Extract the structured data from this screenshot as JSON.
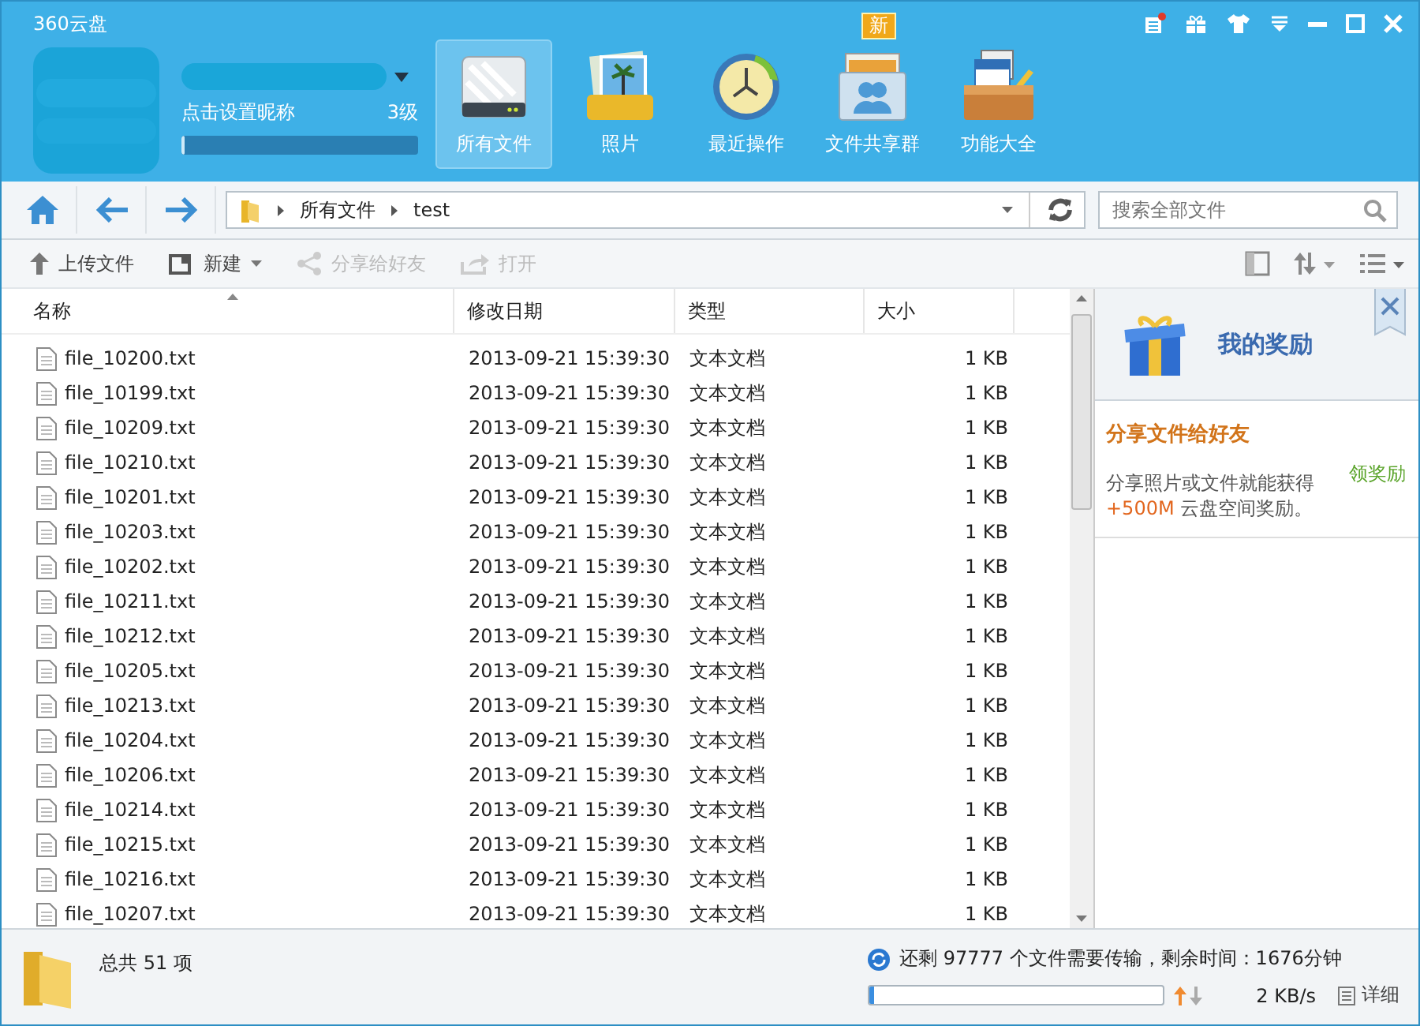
{
  "app_title": "360云盘",
  "user": {
    "setting_prompt": "点击设置昵称",
    "grade": "3级",
    "level": 0.01
  },
  "nav_tabs": [
    {
      "label": "所有文件",
      "kind": "drive",
      "selected": true
    },
    {
      "label": "照片",
      "kind": "photos",
      "selected": false
    },
    {
      "label": "最近操作",
      "kind": "clock",
      "selected": false
    },
    {
      "label": "文件共享群",
      "kind": "share",
      "selected": false,
      "badge": "新"
    },
    {
      "label": "功能大全",
      "kind": "toolbox",
      "selected": false
    }
  ],
  "breadcrumb": [
    "所有文件",
    "test"
  ],
  "search": {
    "placeholder": "搜索全部文件"
  },
  "toolbar": [
    {
      "label": "上传文件",
      "kind": "upload",
      "disabled": false,
      "dropdown": false
    },
    {
      "label": "新建",
      "kind": "new",
      "disabled": false,
      "dropdown": true
    },
    {
      "label": "分享给好友",
      "kind": "share",
      "disabled": true,
      "dropdown": false
    },
    {
      "label": "打开",
      "kind": "open",
      "disabled": true,
      "dropdown": false
    }
  ],
  "table": {
    "columns": [
      "名称",
      "修改日期",
      "类型",
      "大小"
    ],
    "rows": [
      {
        "name": "file_10200.txt",
        "modified": "2013-09-21 15:39:30",
        "type": "文本文档",
        "size": "1 KB"
      },
      {
        "name": "file_10199.txt",
        "modified": "2013-09-21 15:39:30",
        "type": "文本文档",
        "size": "1 KB"
      },
      {
        "name": "file_10209.txt",
        "modified": "2013-09-21 15:39:30",
        "type": "文本文档",
        "size": "1 KB"
      },
      {
        "name": "file_10210.txt",
        "modified": "2013-09-21 15:39:30",
        "type": "文本文档",
        "size": "1 KB"
      },
      {
        "name": "file_10201.txt",
        "modified": "2013-09-21 15:39:30",
        "type": "文本文档",
        "size": "1 KB"
      },
      {
        "name": "file_10203.txt",
        "modified": "2013-09-21 15:39:30",
        "type": "文本文档",
        "size": "1 KB"
      },
      {
        "name": "file_10202.txt",
        "modified": "2013-09-21 15:39:30",
        "type": "文本文档",
        "size": "1 KB"
      },
      {
        "name": "file_10211.txt",
        "modified": "2013-09-21 15:39:30",
        "type": "文本文档",
        "size": "1 KB"
      },
      {
        "name": "file_10212.txt",
        "modified": "2013-09-21 15:39:30",
        "type": "文本文档",
        "size": "1 KB"
      },
      {
        "name": "file_10205.txt",
        "modified": "2013-09-21 15:39:30",
        "type": "文本文档",
        "size": "1 KB"
      },
      {
        "name": "file_10213.txt",
        "modified": "2013-09-21 15:39:30",
        "type": "文本文档",
        "size": "1 KB"
      },
      {
        "name": "file_10204.txt",
        "modified": "2013-09-21 15:39:30",
        "type": "文本文档",
        "size": "1 KB"
      },
      {
        "name": "file_10206.txt",
        "modified": "2013-09-21 15:39:30",
        "type": "文本文档",
        "size": "1 KB"
      },
      {
        "name": "file_10214.txt",
        "modified": "2013-09-21 15:39:30",
        "type": "文本文档",
        "size": "1 KB"
      },
      {
        "name": "file_10215.txt",
        "modified": "2013-09-21 15:39:30",
        "type": "文本文档",
        "size": "1 KB"
      },
      {
        "name": "file_10216.txt",
        "modified": "2013-09-21 15:39:30",
        "type": "文本文档",
        "size": "1 KB"
      },
      {
        "name": "file_10207.txt",
        "modified": "2013-09-21 15:39:30",
        "type": "文本文档",
        "size": "1 KB"
      }
    ]
  },
  "reward_panel": {
    "title": "我的奖励",
    "heading": "分享文件给好友",
    "claim_link": "领奖励",
    "description": "分享照片或文件就能获得",
    "bonus": "+500M",
    "description_end": "云盘空间奖励。"
  },
  "status_bar": {
    "total": "总共 51 项",
    "transfer": "还剩 97777 个文件需要传输，剩余时间：1676分钟",
    "level": 0.01,
    "speed": "2 KB/s",
    "details": "详细"
  }
}
